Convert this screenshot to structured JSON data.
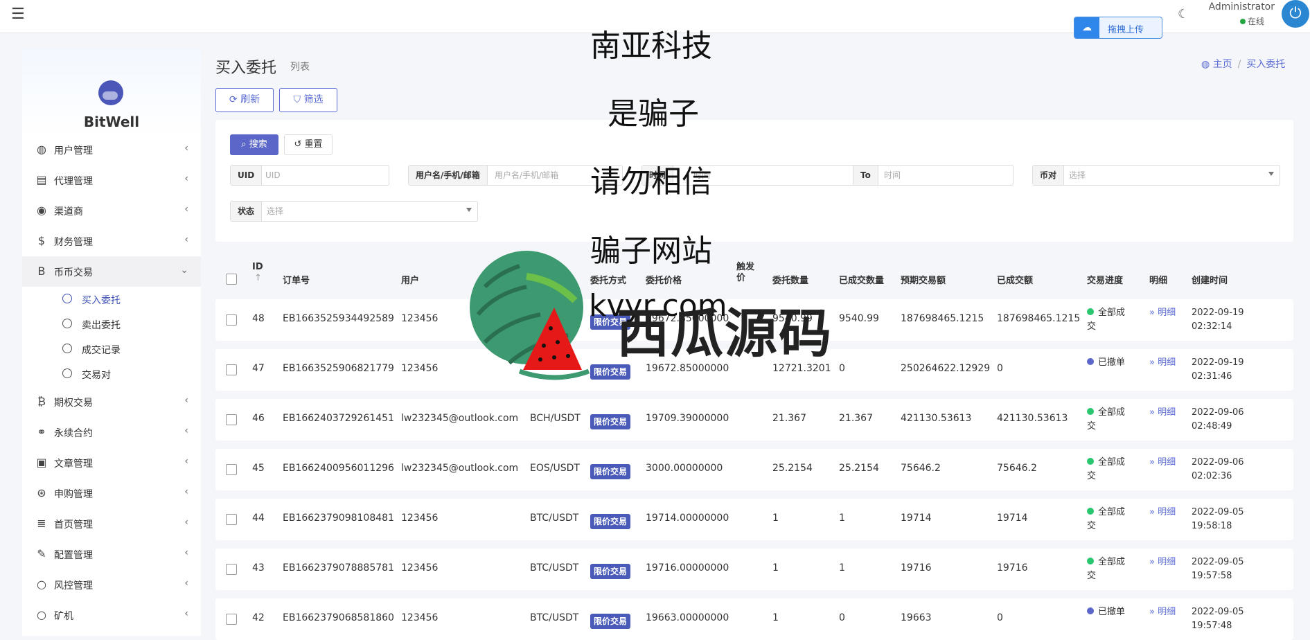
{
  "topbar": {
    "upload_label": "拖拽上传",
    "admin_name": "Administrator",
    "online_label": "在线"
  },
  "sidebar": {
    "logo_text": "BitWell",
    "items": [
      {
        "label": "用户管理",
        "icon": "dashboard-icon",
        "glyph": "◍"
      },
      {
        "label": "代理管理",
        "icon": "id-card-icon",
        "glyph": "▤"
      },
      {
        "label": "渠道商",
        "icon": "user-circle-icon",
        "glyph": "◉"
      },
      {
        "label": "财务管理",
        "icon": "dollar-icon",
        "glyph": "$"
      },
      {
        "label": "币币交易",
        "icon": "bitcoin-icon",
        "glyph": "B"
      }
    ],
    "sub_items": [
      {
        "label": "买入委托"
      },
      {
        "label": "卖出委托"
      },
      {
        "label": "成交记录"
      },
      {
        "label": "交易对"
      }
    ],
    "items_after": [
      {
        "label": "期权交易",
        "icon": "bitcoin-icon",
        "glyph": "₿"
      },
      {
        "label": "永续合约",
        "icon": "link-icon",
        "glyph": "⚭"
      },
      {
        "label": "文章管理",
        "icon": "newspaper-icon",
        "glyph": "▣"
      },
      {
        "label": "申购管理",
        "icon": "life-ring-icon",
        "glyph": "⊛"
      },
      {
        "label": "首页管理",
        "icon": "list-icon",
        "glyph": "≣"
      },
      {
        "label": "配置管理",
        "icon": "wrench-icon",
        "glyph": "✎"
      },
      {
        "label": "风控管理",
        "icon": "circle-icon",
        "glyph": "○"
      },
      {
        "label": "矿机",
        "icon": "circle-icon",
        "glyph": "○"
      }
    ]
  },
  "page": {
    "title": "买入委托",
    "subtitle": "列表",
    "breadcrumb_home": "主页",
    "breadcrumb_current": "买入委托"
  },
  "toolbar": {
    "refresh_label": "刷新",
    "filter_label": "筛选"
  },
  "filter": {
    "search_label": "搜索",
    "reset_label": "重置",
    "uid_label": "UID",
    "uid_placeholder": "UID",
    "user_label": "用户名/手机/邮箱",
    "user_placeholder": "用户名/手机/邮箱",
    "time_label": "时间",
    "time_placeholder": "时间",
    "to_label": "To",
    "to_placeholder": "时间",
    "pair_label": "币对",
    "pair_placeholder": "选择",
    "status_label": "状态",
    "status_placeholder": "选择"
  },
  "table": {
    "headers": {
      "id": "ID",
      "sort": "↑",
      "order_no": "订单号",
      "user": "用户",
      "type": "委托方式",
      "price": "委托价格",
      "trigger": "触发价",
      "qty": "委托数量",
      "filled_qty": "已成交数量",
      "expected_amount": "预期交易额",
      "filled_amount": "已成交额",
      "progress": "交易进度",
      "detail": "明细",
      "created": "创建时间"
    },
    "rows": [
      {
        "id": "48",
        "order": "EB1663525934492589",
        "user": "123456",
        "pair": "",
        "type": "限价交易",
        "price": "19672.85000000",
        "qty": "9540.99",
        "filled": "9540.99",
        "expected": "187698465.1215",
        "filled_amt": "187698465.1215",
        "status": "全部成交",
        "status_color": "#28c76f",
        "detail": "» 明细",
        "date": "2022-09-19",
        "time": "02:32:14"
      },
      {
        "id": "47",
        "order": "EB1663525906821779",
        "user": "123456",
        "pair": "",
        "type": "限价交易",
        "price": "19672.85000000",
        "qty": "12721.3201",
        "filled": "0",
        "expected": "250264622.12929",
        "filled_amt": "0",
        "status": "已撤单",
        "status_color": "#5a67c8",
        "detail": "» 明细",
        "date": "2022-09-19",
        "time": "02:31:46"
      },
      {
        "id": "46",
        "order": "EB1662403729261451",
        "user": "lw232345@outlook.com",
        "pair": "BCH/USDT",
        "type": "限价交易",
        "price": "19709.39000000",
        "qty": "21.367",
        "filled": "21.367",
        "expected": "421130.53613",
        "filled_amt": "421130.53613",
        "status": "全部成交",
        "status_color": "#28c76f",
        "detail": "» 明细",
        "date": "2022-09-06",
        "time": "02:48:49"
      },
      {
        "id": "45",
        "order": "EB1662400956011296",
        "user": "lw232345@outlook.com",
        "pair": "EOS/USDT",
        "type": "限价交易",
        "price": "3000.00000000",
        "qty": "25.2154",
        "filled": "25.2154",
        "expected": "75646.2",
        "filled_amt": "75646.2",
        "status": "全部成交",
        "status_color": "#28c76f",
        "detail": "» 明细",
        "date": "2022-09-06",
        "time": "02:02:36"
      },
      {
        "id": "44",
        "order": "EB1662379098108481",
        "user": "123456",
        "pair": "BTC/USDT",
        "type": "限价交易",
        "price": "19714.00000000",
        "qty": "1",
        "filled": "1",
        "expected": "19714",
        "filled_amt": "19714",
        "status": "全部成交",
        "status_color": "#28c76f",
        "detail": "» 明细",
        "date": "2022-09-05",
        "time": "19:58:18"
      },
      {
        "id": "43",
        "order": "EB1662379078885781",
        "user": "123456",
        "pair": "BTC/USDT",
        "type": "限价交易",
        "price": "19716.00000000",
        "qty": "1",
        "filled": "1",
        "expected": "19716",
        "filled_amt": "19716",
        "status": "全部成交",
        "status_color": "#28c76f",
        "detail": "» 明细",
        "date": "2022-09-05",
        "time": "19:57:58"
      },
      {
        "id": "42",
        "order": "EB1662379068581860",
        "user": "123456",
        "pair": "BTC/USDT",
        "type": "限价交易",
        "price": "19663.00000000",
        "qty": "1",
        "filled": "0",
        "expected": "19663",
        "filled_amt": "0",
        "status": "已撤单",
        "status_color": "#5a67c8",
        "detail": "» 明细",
        "date": "2022-09-05",
        "time": "19:57:48"
      }
    ]
  },
  "overlay": {
    "line1": "南亚科技",
    "line2": "是骗子",
    "line3": "请勿相信",
    "line4": "骗子网站",
    "line5": "kvyr.com",
    "watermark": "西瓜源码"
  }
}
